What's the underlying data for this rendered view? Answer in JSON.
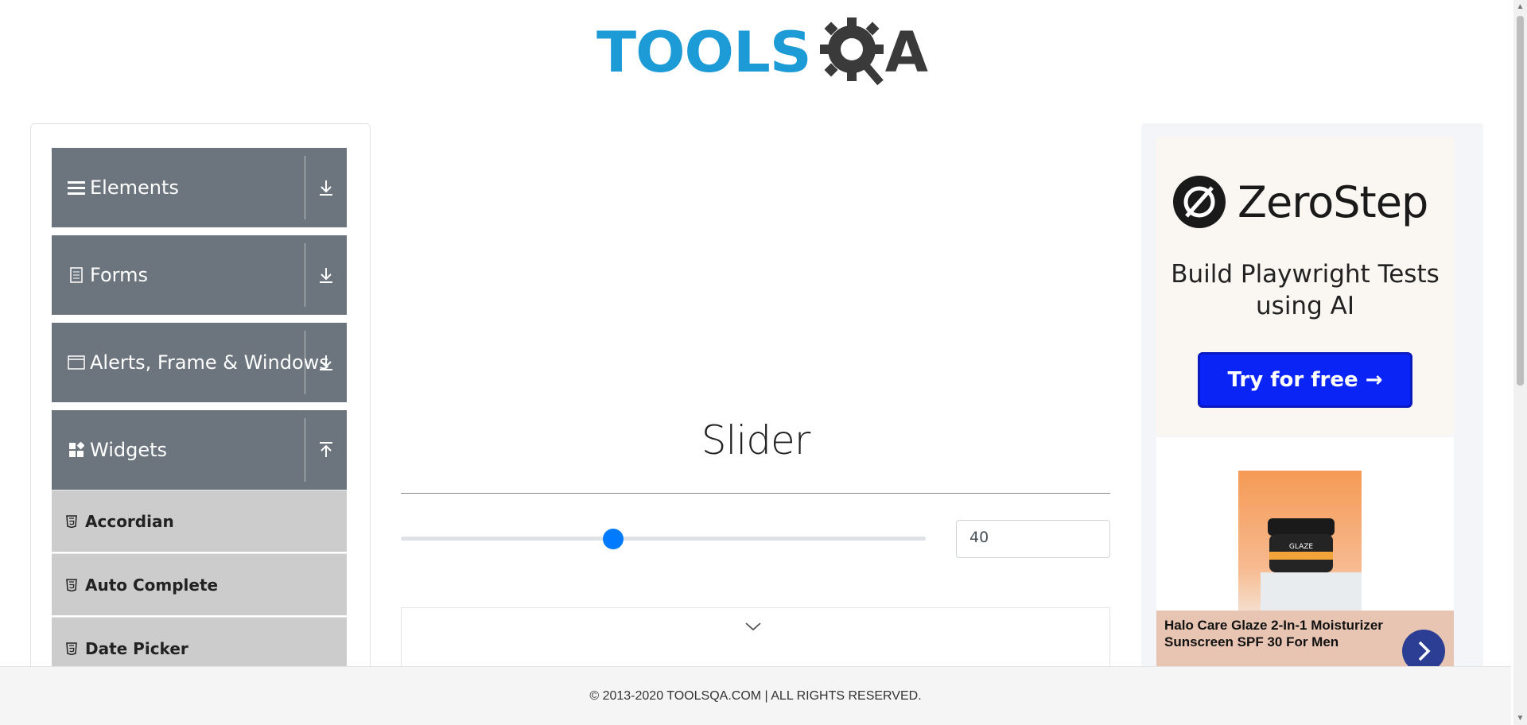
{
  "header": {
    "logo_tools": "TOOLS",
    "logo_a": "A"
  },
  "sidebar": {
    "groups": [
      {
        "label": "Elements",
        "icon": "hamburger-icon",
        "state": "collapsed"
      },
      {
        "label": "Forms",
        "icon": "document-icon",
        "state": "collapsed"
      },
      {
        "label": "Alerts, Frame & Windows",
        "icon": "window-icon",
        "state": "collapsed"
      },
      {
        "label": "Widgets",
        "icon": "widgets-icon",
        "state": "expanded"
      }
    ],
    "items": [
      {
        "label": "Accordian",
        "icon": "html5-icon"
      },
      {
        "label": "Auto Complete",
        "icon": "html5-icon"
      },
      {
        "label": "Date Picker",
        "icon": "html5-icon"
      }
    ]
  },
  "main": {
    "title": "Slider",
    "slider": {
      "value": "40",
      "min": 0,
      "max": 100
    }
  },
  "ad": {
    "brand": "ZeroStep",
    "headline": "Build Playwright Tests using AI",
    "cta": "Try for free →",
    "product_caption": "Halo Care Glaze 2-In-1 Moisturizer Sunscreen SPF 30 For Men",
    "jar_label": "GLAZE"
  },
  "footer": {
    "copyright": "© 2013-2020 TOOLSQA.COM | ALL RIGHTS RESERVED."
  },
  "colors": {
    "group_bg": "#6c757d",
    "item_bg": "#cccccc",
    "slider_thumb": "#007bff",
    "logo_blue": "#1d9bd7",
    "cta_blue": "#0a24f5"
  }
}
